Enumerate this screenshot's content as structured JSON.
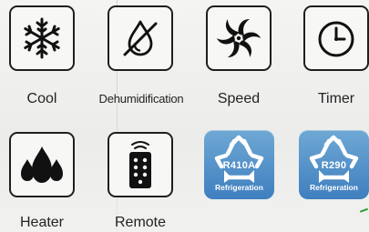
{
  "features": [
    {
      "id": "cool",
      "label": "Cool",
      "icon": "snowflake-icon"
    },
    {
      "id": "dehumidification",
      "label": "Dehumidification",
      "icon": "water-drop-off-icon"
    },
    {
      "id": "speed",
      "label": "Speed",
      "icon": "fan-icon"
    },
    {
      "id": "timer",
      "label": "Timer",
      "icon": "clock-icon"
    },
    {
      "id": "heater",
      "label": "Heater",
      "icon": "flame-icon"
    },
    {
      "id": "remote",
      "label": "Remote",
      "icon": "remote-control-icon"
    }
  ],
  "refrigerants": [
    {
      "id": "r410a",
      "code": "R410A",
      "caption": "Refrigeration",
      "icon": "recycle-icon"
    },
    {
      "id": "r290",
      "code": "R290",
      "caption": "Refrigeration",
      "icon": "recycle-icon"
    }
  ],
  "colors": {
    "tile_border": "#1f1f1f",
    "icon_black": "#111111",
    "badge_blue_top": "#6fa8d4",
    "badge_blue_bottom": "#3f7fbf",
    "label_text": "#222222"
  }
}
